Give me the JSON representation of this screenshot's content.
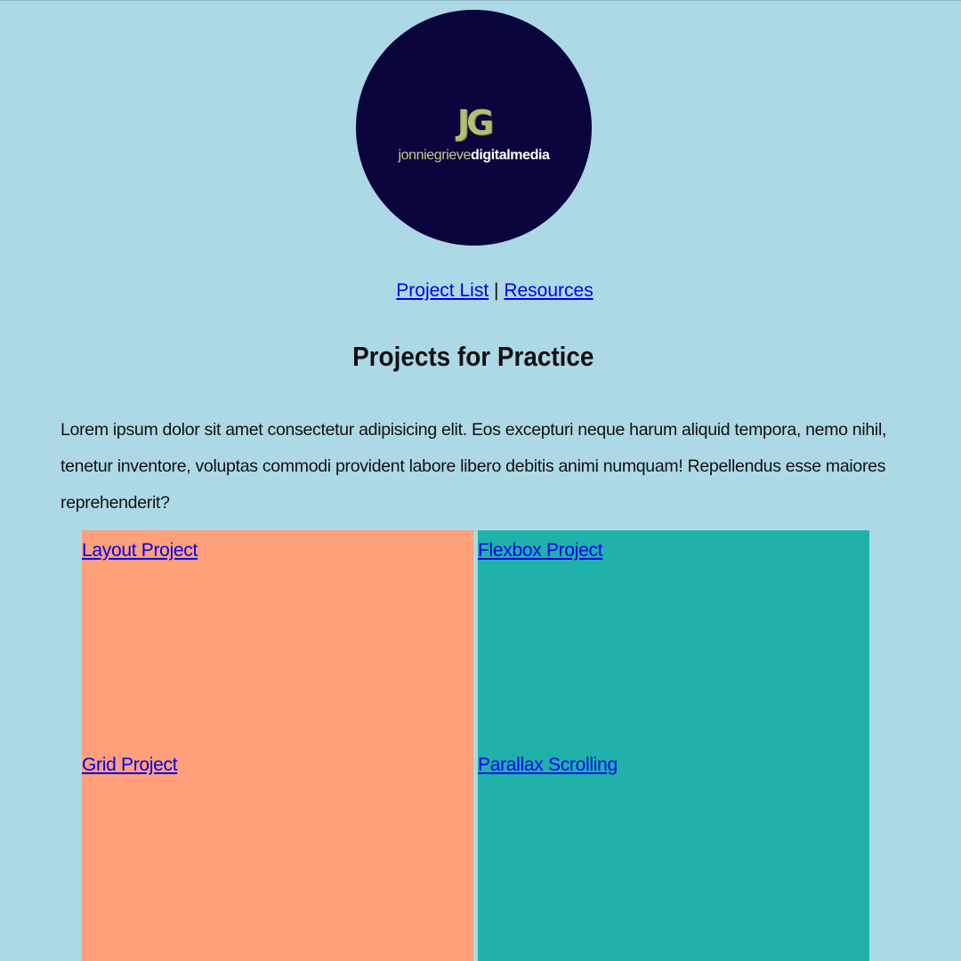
{
  "logo": {
    "mark": "JG",
    "text_part1": "jonniegrieve",
    "text_part2": "digitalmedia"
  },
  "nav": {
    "project_list": "Project List",
    "separator": "|",
    "resources": "Resources"
  },
  "page_title": "Projects for Practice",
  "intro_text": "Lorem ipsum dolor sit amet consectetur adipisicing elit. Eos excepturi neque harum aliquid tempora, nemo nihil, tenetur inventore, voluptas commodi provident labore libero debitis animi numquam! Repellendus esse maiores reprehenderit?",
  "projects": {
    "layout": "Layout Project",
    "flexbox": "Flexbox Project",
    "grid": "Grid Project",
    "parallax": "Parallax Scrolling"
  },
  "colors": {
    "background": "#add8e6",
    "logo_circle": "#0a053c",
    "tile_left": "#ffa07a",
    "tile_right": "#20b2aa",
    "link": "#0000ee"
  }
}
